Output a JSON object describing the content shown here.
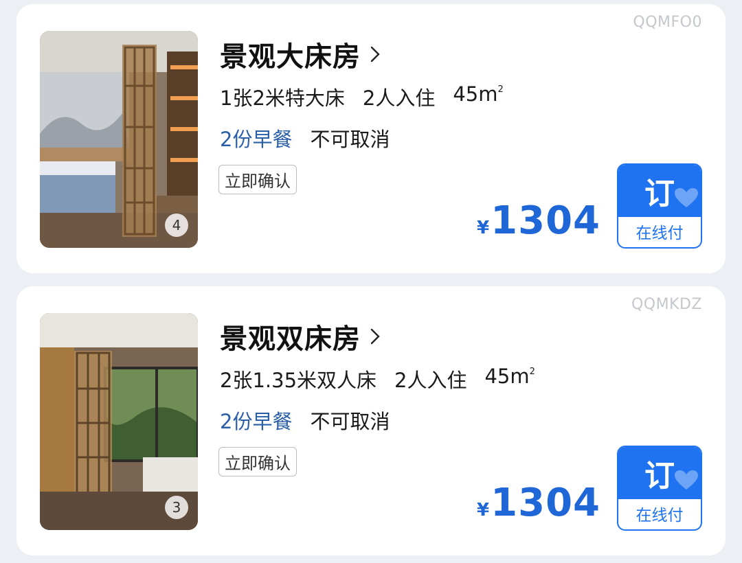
{
  "rooms": [
    {
      "code": "QQMFO0",
      "title": "景观大床房",
      "bed": "1张2米特大床",
      "occupancy": "2人入住",
      "area": "45m",
      "area_sup": "2",
      "breakfast": "2份早餐",
      "cancel_policy": "不可取消",
      "tag": "立即确认",
      "currency": "¥",
      "price": "1304",
      "photo_count": "4",
      "book_label": "订",
      "pay_label": "在线付"
    },
    {
      "code": "QQMKDZ",
      "title": "景观双床房",
      "bed": "2张1.35米双人床",
      "occupancy": "2人入住",
      "area": "45m",
      "area_sup": "2",
      "breakfast": "2份早餐",
      "cancel_policy": "不可取消",
      "tag": "立即确认",
      "currency": "¥",
      "price": "1304",
      "photo_count": "3",
      "book_label": "订",
      "pay_label": "在线付"
    }
  ],
  "colors": {
    "accent": "#1f73f0",
    "price": "#1f66d6",
    "breakfast": "#2a5fa8",
    "code": "#c4c7cc"
  },
  "icons": {
    "chevron": "chevron-right-icon",
    "heart": "heart-icon"
  }
}
